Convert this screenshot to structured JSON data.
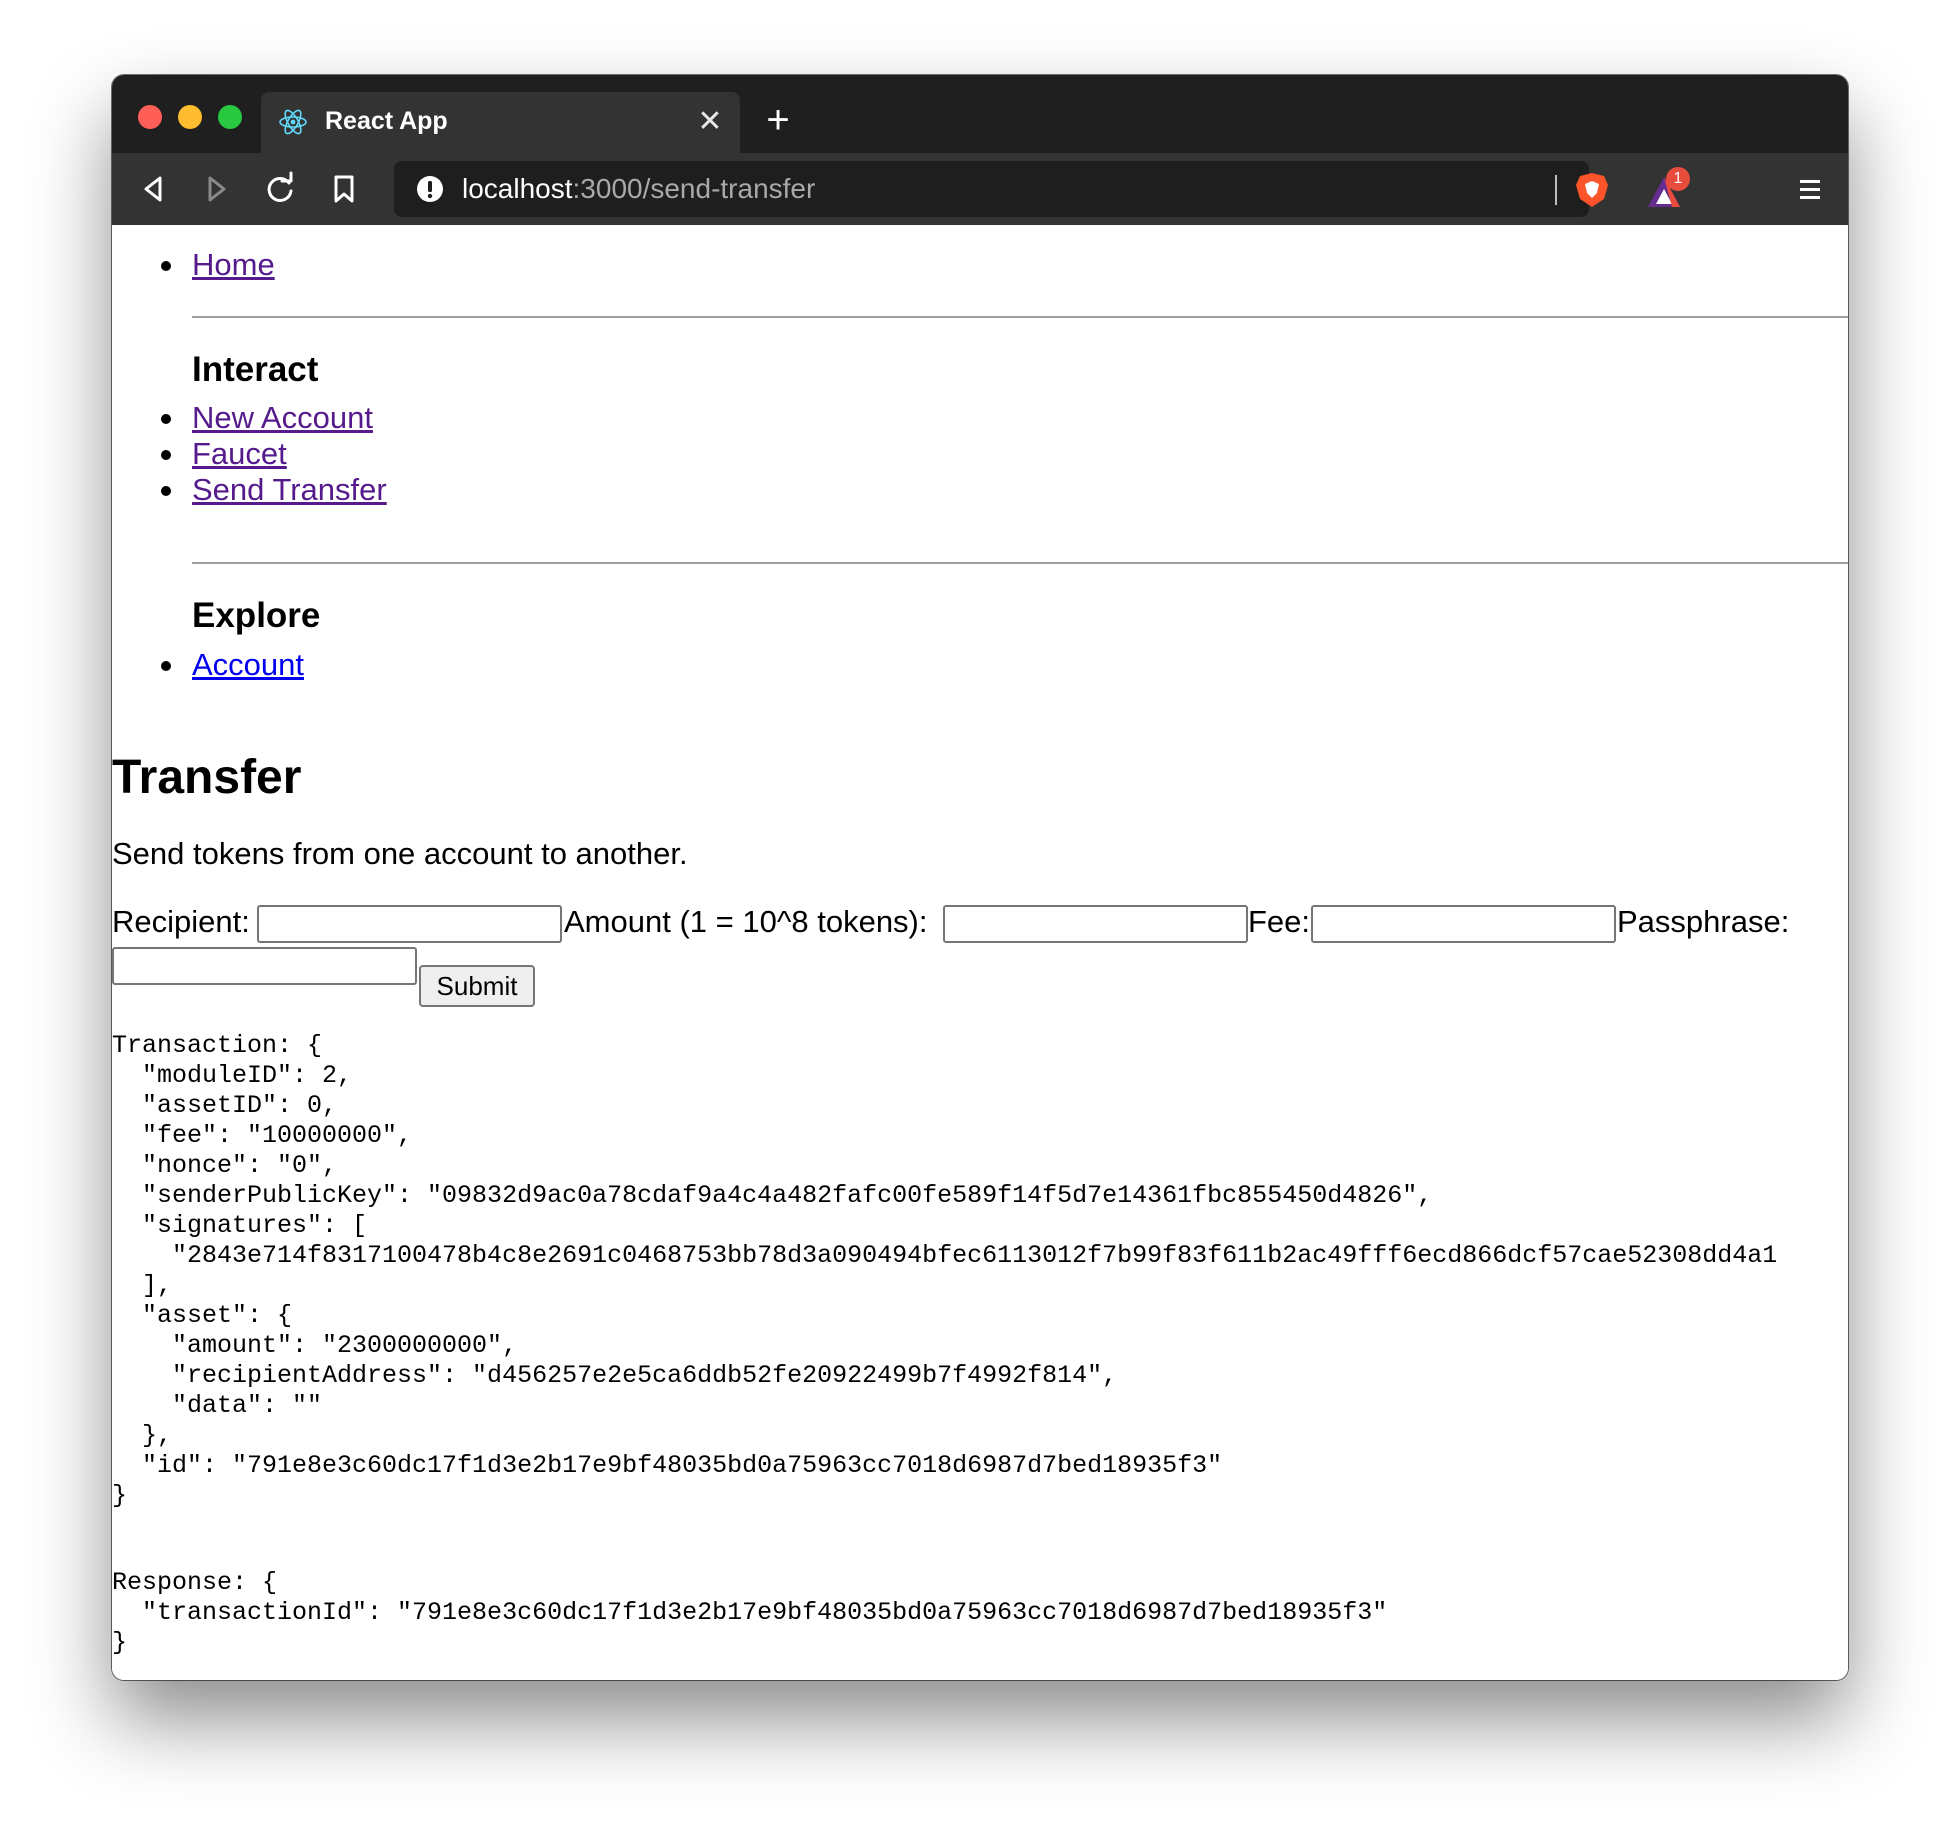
{
  "browser": {
    "tab_title": "React App",
    "tab_close_icon": "close-icon",
    "url_host": "localhost",
    "url_path": ":3000/send-transfer",
    "rewards_badge_count": "1"
  },
  "nav": {
    "home": "Home",
    "interact_heading": "Interact",
    "interact_links": [
      "New Account",
      "Faucet",
      "Send Transfer"
    ],
    "explore_heading": "Explore",
    "explore_links": [
      "Account"
    ]
  },
  "page": {
    "title": "Transfer",
    "description": "Send tokens from one account to another."
  },
  "form": {
    "recipient_label": "Recipient:",
    "recipient_value": "",
    "amount_label": "Amount (1 = 10^8 tokens):",
    "amount_value": "",
    "fee_label": "Fee:",
    "fee_value": "",
    "passphrase_label": "Passphrase:",
    "passphrase_value": "",
    "submit_label": "Submit"
  },
  "output": {
    "transaction_text": "Transaction: {\n  \"moduleID\": 2,\n  \"assetID\": 0,\n  \"fee\": \"10000000\",\n  \"nonce\": \"0\",\n  \"senderPublicKey\": \"09832d9ac0a78cdaf9a4c4a482fafc00fe589f14f5d7e14361fbc855450d4826\",\n  \"signatures\": [\n    \"2843e714f8317100478b4c8e2691c0468753bb78d3a090494bfec6113012f7b99f83f611b2ac49fff6ecd866dcf57cae52308dd4a1\n  ],\n  \"asset\": {\n    \"amount\": \"2300000000\",\n    \"recipientAddress\": \"d456257e2e5ca6ddb52fe20922499b7f4992f814\",\n    \"data\": \"\"\n  },\n  \"id\": \"791e8e3c60dc17f1d3e2b17e9bf48035bd0a75963cc7018d6987d7bed18935f3\"\n}",
    "response_text": "Response: {\n  \"transactionId\": \"791e8e3c60dc17f1d3e2b17e9bf48035bd0a75963cc7018d6987d7bed18935f3\"\n}"
  }
}
